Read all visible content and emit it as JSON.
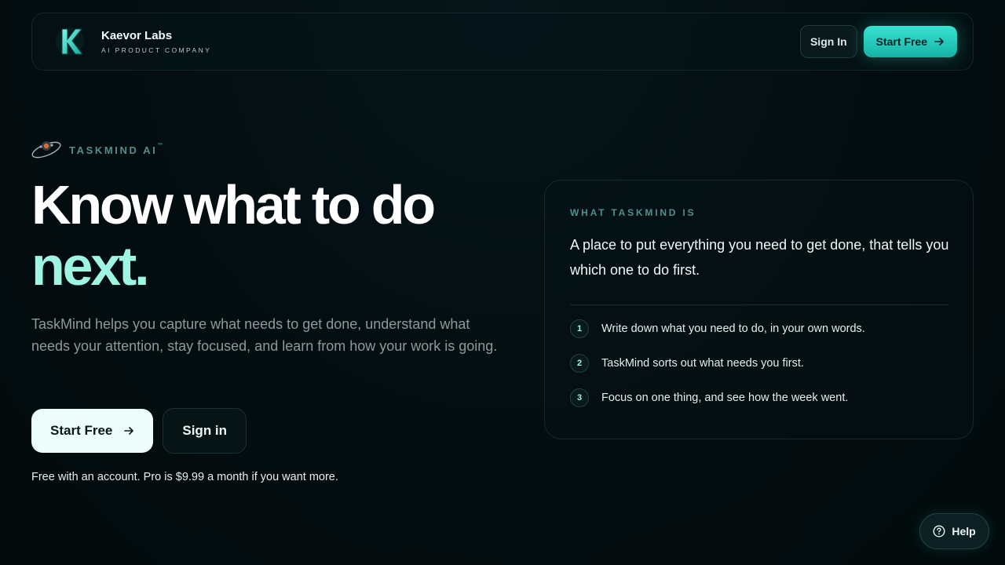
{
  "header": {
    "brand_name": "Kaevor Labs",
    "brand_subtitle": "AI PRODUCT COMPANY",
    "logo_letter": "K",
    "logo_icon": "k-logo-icon",
    "signin_label": "Sign In",
    "start_label": "Start Free"
  },
  "hero": {
    "eyebrow": "TASKMIND AI",
    "eyebrow_mark": "™",
    "eyebrow_icon": "orbit-logo-icon",
    "headline_line1": "Know what to do",
    "headline_line2": "next.",
    "lead": "TaskMind helps you capture what needs to get done, understand what needs your attention, stay focused, and learn from how your work is going.",
    "start_label": "Start Free",
    "signin_label": "Sign in",
    "note": "Free with an account. Pro is $9.99 a month if you want more."
  },
  "card": {
    "eyebrow": "WHAT TASKMIND IS",
    "title": "A place to put everything you need to get done, that tells you which one to do first.",
    "steps": [
      {
        "num": "1",
        "text": "Write down what you need to do, in your own words."
      },
      {
        "num": "2",
        "text": "TaskMind sorts out what needs you first."
      },
      {
        "num": "3",
        "text": "Focus on one thing, and see how the week went."
      }
    ]
  },
  "help": {
    "label": "Help",
    "icon": "question-circle-icon"
  },
  "colors": {
    "background": "#030d0f",
    "accent": "#2ad6c6",
    "accent_light": "#9ef5e4",
    "muted_teal": "#4f8f8d"
  }
}
